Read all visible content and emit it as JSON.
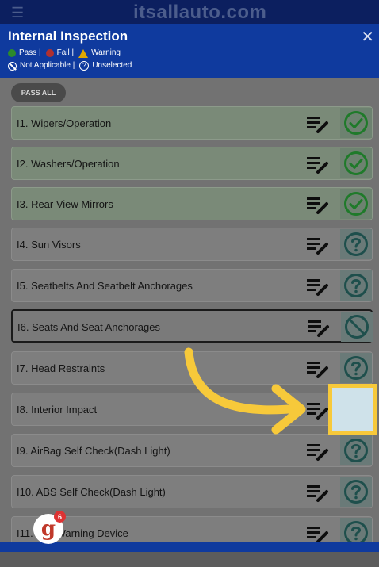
{
  "brand": "itsallauto.com",
  "header": {
    "title": "Internal Inspection",
    "legend": {
      "pass": "Pass |",
      "fail": "Fail |",
      "warning": "Warning",
      "not_applicable": "Not Applicable |",
      "unselected": "Unselected"
    }
  },
  "pass_all_label": "PASS ALL",
  "items": [
    {
      "label": "I1. Wipers/Operation",
      "status": "pass"
    },
    {
      "label": "I2. Washers/Operation",
      "status": "pass"
    },
    {
      "label": "I3. Rear View Mirrors",
      "status": "pass"
    },
    {
      "label": "I4. Sun Visors",
      "status": "unselected"
    },
    {
      "label": "I5. Seatbelts And Seatbelt Anchorages",
      "status": "unselected"
    },
    {
      "label": "I6. Seats And Seat Anchorages",
      "status": "not-applicable"
    },
    {
      "label": "I7. Head Restraints",
      "status": "unselected"
    },
    {
      "label": "I8. Interior Impact",
      "status": "unselected"
    },
    {
      "label": "I9. AirBag Self Check(Dash Light)",
      "status": "unselected"
    },
    {
      "label": "I10. ABS Self Check(Dash Light)",
      "status": "unselected"
    },
    {
      "label": "I11. ... e Warning Device",
      "status": "unselected"
    }
  ],
  "badge": {
    "letter": "g",
    "count": "6"
  },
  "colors": {
    "brand_blue": "#0f3a9e",
    "pass_green": "#1f7a2a",
    "unselected_teal": "#1e4f4c",
    "highlight": "#f7c93a"
  }
}
